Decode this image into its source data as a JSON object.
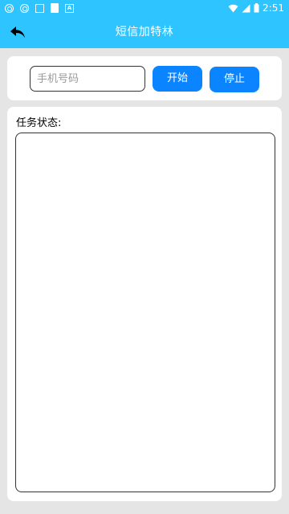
{
  "statusbar": {
    "time": "2:51",
    "left_icons": [
      "swirl-icon",
      "swirl-icon",
      "image-icon",
      "doc-icon",
      "a-icon"
    ],
    "right_icons": [
      "wifi-icon",
      "signal-icon",
      "battery-icon"
    ]
  },
  "appbar": {
    "title": "短信加特林",
    "back_icon": "back-arrow-icon"
  },
  "controls": {
    "phone_placeholder": "手机号码",
    "phone_value": "",
    "start_label": "开始",
    "stop_label": "停止"
  },
  "task": {
    "label": "任务状态:",
    "log": ""
  },
  "colors": {
    "primary": "#2ec4ff",
    "button": "#0a84ff",
    "background": "#e5e5e5"
  }
}
